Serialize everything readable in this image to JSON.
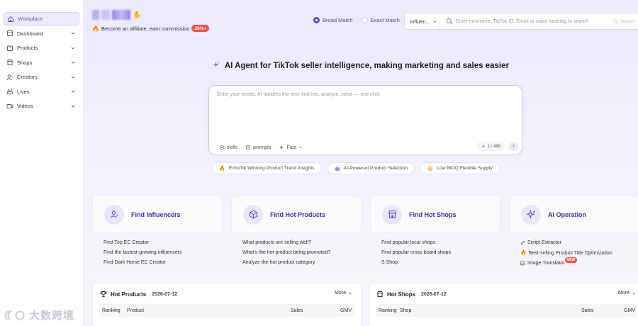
{
  "sidebar": {
    "items": [
      {
        "label": "Workplace",
        "icon": "home-icon",
        "active": true
      },
      {
        "label": "Dashboard",
        "icon": "dashboard-icon"
      },
      {
        "label": "Products",
        "icon": "products-icon"
      },
      {
        "label": "Shops",
        "icon": "shop-icon"
      },
      {
        "label": "Creators",
        "icon": "creators-icon"
      },
      {
        "label": "Lives",
        "icon": "lives-icon"
      },
      {
        "label": "Videos",
        "icon": "videos-icon"
      }
    ],
    "watermark": "大数跨境"
  },
  "header": {
    "affiliate_text": "Become an affiliate, earn commission",
    "affiliate_badge": "20%+",
    "broad_match": "Broad Match",
    "exact_match": "Exact Match",
    "search_type": "Influen...",
    "search_placeholder": "Enter nickname, TikTok ID, Email or video hashtag to search",
    "search_button": "Search"
  },
  "hero": {
    "headline": "AI Agent for TikTok seller intelligence, making marketing and sales easier",
    "input_placeholder": "Enter your needs. AI handles the rest: find hits, analyze, solve — one click.",
    "tools": [
      "skills",
      "prompts",
      "Fast"
    ],
    "counter": "1 / 498"
  },
  "chips": [
    "EchoTik Winning Product Trend Insights",
    "AI-Powered Product Selection",
    "Low MOQ Flexible Supply"
  ],
  "cards": [
    {
      "title": "Find Influencers",
      "links": [
        "Find Top EC Creator",
        "Find the fastest-growing influencers",
        "Find Dark Horse EC Creator"
      ]
    },
    {
      "title": "Find Hot Products",
      "links": [
        "What products are selling well?",
        "What's the hot product being promoted?",
        "Analyze the hot product category"
      ]
    },
    {
      "title": "Find Hot Shops",
      "links": [
        "Find popular local shops",
        "Find popular cross board shops",
        "S Shop"
      ]
    },
    {
      "title": "AI Operation",
      "links": [
        "Script Extractor",
        "Best-selling Product Title Optimization",
        "Image Translator"
      ],
      "new_badge": "NEW"
    }
  ],
  "hot_products": {
    "title": "Hot Products",
    "date": "2026-07-12",
    "more": "More",
    "columns": [
      "Ranking",
      "Product",
      "Sales",
      "GMV"
    ]
  },
  "hot_shops": {
    "title": "Hot Shops",
    "date": "2026-07-12",
    "more": "More",
    "columns": [
      "Ranking",
      "Shop",
      "Sales",
      "GMV"
    ]
  },
  "colors": {
    "accent": "#5b4fd9",
    "badge": "#ff4d4f",
    "card_title": "#3b3399"
  }
}
